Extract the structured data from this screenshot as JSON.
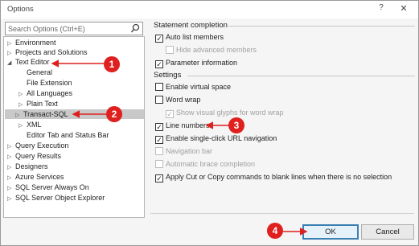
{
  "window": {
    "title": "Options",
    "help_glyph": "?",
    "close_glyph": "✕"
  },
  "search": {
    "placeholder": "Search Options (Ctrl+E)",
    "icon": "search-icon"
  },
  "tree": [
    {
      "label": "Environment",
      "expanded": false
    },
    {
      "label": "Projects and Solutions",
      "expanded": false
    },
    {
      "label": "Text Editor",
      "expanded": true
    },
    {
      "label": "General",
      "leaf": true
    },
    {
      "label": "File Extension",
      "leaf": true
    },
    {
      "label": "All Languages",
      "expanded": false
    },
    {
      "label": "Plain Text",
      "expanded": false
    },
    {
      "label": "Transact-SQL",
      "expanded": false,
      "selected": true
    },
    {
      "label": "XML",
      "expanded": false
    },
    {
      "label": "Editor Tab and Status Bar",
      "leaf": true
    },
    {
      "label": "Query Execution",
      "expanded": false
    },
    {
      "label": "Query Results",
      "expanded": false
    },
    {
      "label": "Designers",
      "expanded": false
    },
    {
      "label": "Azure Services",
      "expanded": false
    },
    {
      "label": "SQL Server Always On",
      "expanded": false
    },
    {
      "label": "SQL Server Object Explorer",
      "expanded": false
    }
  ],
  "statement_completion": {
    "heading": "Statement completion",
    "options": [
      {
        "label": "Auto list members",
        "checked": true,
        "enabled": true
      },
      {
        "label": "Hide advanced members",
        "checked": false,
        "enabled": false
      },
      {
        "label": "Parameter information",
        "checked": true,
        "enabled": true
      }
    ]
  },
  "settings": {
    "heading": "Settings",
    "options": [
      {
        "label": "Enable virtual space",
        "checked": false,
        "enabled": true
      },
      {
        "label": "Word wrap",
        "checked": false,
        "enabled": true
      },
      {
        "label": "Show visual glyphs for word wrap",
        "checked": true,
        "enabled": false
      },
      {
        "label": "Line numbers",
        "checked": true,
        "enabled": true
      },
      {
        "label": "Enable single-click URL navigation",
        "checked": true,
        "enabled": true
      },
      {
        "label": "Navigation bar",
        "checked": false,
        "enabled": false
      },
      {
        "label": "Automatic brace completion",
        "checked": false,
        "enabled": false
      },
      {
        "label": "Apply Cut or Copy commands to blank lines when there is no selection",
        "checked": true,
        "enabled": true
      }
    ]
  },
  "buttons": {
    "ok": "OK",
    "cancel": "Cancel"
  },
  "annotations": {
    "badge_1": "1",
    "badge_2": "2",
    "badge_3": "3",
    "badge_4": "4",
    "color": "#e01f1f"
  }
}
